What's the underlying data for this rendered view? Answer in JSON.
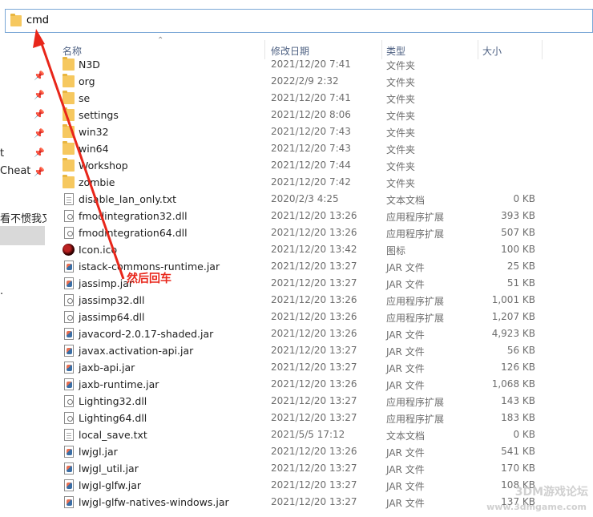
{
  "address": {
    "path": "cmd"
  },
  "nav": {
    "items": [
      {
        "label": "t"
      },
      {
        "label": "Cheat"
      },
      {
        "label": "看不惯我又"
      },
      {
        "label": "."
      }
    ]
  },
  "header": {
    "name": "名称",
    "date": "修改日期",
    "type": "类型",
    "size": "大小"
  },
  "files": [
    {
      "name": "N3D",
      "date": "2021/12/20 7:41",
      "type": "文件夹",
      "size": "",
      "icon": "folder-icon"
    },
    {
      "name": "org",
      "date": "2022/2/9 2:32",
      "type": "文件夹",
      "size": "",
      "icon": "folder-icon"
    },
    {
      "name": "se",
      "date": "2021/12/20 7:41",
      "type": "文件夹",
      "size": "",
      "icon": "folder-icon"
    },
    {
      "name": "settings",
      "date": "2021/12/20 8:06",
      "type": "文件夹",
      "size": "",
      "icon": "folder-icon"
    },
    {
      "name": "win32",
      "date": "2021/12/20 7:43",
      "type": "文件夹",
      "size": "",
      "icon": "folder-icon"
    },
    {
      "name": "win64",
      "date": "2021/12/20 7:43",
      "type": "文件夹",
      "size": "",
      "icon": "folder-icon"
    },
    {
      "name": "Workshop",
      "date": "2021/12/20 7:44",
      "type": "文件夹",
      "size": "",
      "icon": "folder-icon"
    },
    {
      "name": "zombie",
      "date": "2021/12/20 7:42",
      "type": "文件夹",
      "size": "",
      "icon": "folder-icon"
    },
    {
      "name": "disable_lan_only.txt",
      "date": "2020/2/3 4:25",
      "type": "文本文档",
      "size": "0 KB",
      "icon": "text-file-icon"
    },
    {
      "name": "fmodintegration32.dll",
      "date": "2021/12/20 13:26",
      "type": "应用程序扩展",
      "size": "393 KB",
      "icon": "dll-file-icon"
    },
    {
      "name": "fmodintegration64.dll",
      "date": "2021/12/20 13:26",
      "type": "应用程序扩展",
      "size": "507 KB",
      "icon": "dll-file-icon"
    },
    {
      "name": "Icon.ico",
      "date": "2021/12/20 13:42",
      "type": "图标",
      "size": "100 KB",
      "icon": "ico-file-icon"
    },
    {
      "name": "istack-commons-runtime.jar",
      "date": "2021/12/20 13:27",
      "type": "JAR 文件",
      "size": "25 KB",
      "icon": "jar-file-icon"
    },
    {
      "name": "jassimp.jar",
      "date": "2021/12/20 13:27",
      "type": "JAR 文件",
      "size": "51 KB",
      "icon": "jar-file-icon"
    },
    {
      "name": "jassimp32.dll",
      "date": "2021/12/20 13:26",
      "type": "应用程序扩展",
      "size": "1,001 KB",
      "icon": "dll-file-icon"
    },
    {
      "name": "jassimp64.dll",
      "date": "2021/12/20 13:26",
      "type": "应用程序扩展",
      "size": "1,207 KB",
      "icon": "dll-file-icon"
    },
    {
      "name": "javacord-2.0.17-shaded.jar",
      "date": "2021/12/20 13:26",
      "type": "JAR 文件",
      "size": "4,923 KB",
      "icon": "jar-file-icon"
    },
    {
      "name": "javax.activation-api.jar",
      "date": "2021/12/20 13:27",
      "type": "JAR 文件",
      "size": "56 KB",
      "icon": "jar-file-icon"
    },
    {
      "name": "jaxb-api.jar",
      "date": "2021/12/20 13:27",
      "type": "JAR 文件",
      "size": "126 KB",
      "icon": "jar-file-icon"
    },
    {
      "name": "jaxb-runtime.jar",
      "date": "2021/12/20 13:26",
      "type": "JAR 文件",
      "size": "1,068 KB",
      "icon": "jar-file-icon"
    },
    {
      "name": "Lighting32.dll",
      "date": "2021/12/20 13:27",
      "type": "应用程序扩展",
      "size": "143 KB",
      "icon": "dll-file-icon"
    },
    {
      "name": "Lighting64.dll",
      "date": "2021/12/20 13:27",
      "type": "应用程序扩展",
      "size": "183 KB",
      "icon": "dll-file-icon"
    },
    {
      "name": "local_save.txt",
      "date": "2021/5/5 17:12",
      "type": "文本文档",
      "size": "0 KB",
      "icon": "text-file-icon"
    },
    {
      "name": "lwjgl.jar",
      "date": "2021/12/20 13:26",
      "type": "JAR 文件",
      "size": "541 KB",
      "icon": "jar-file-icon"
    },
    {
      "name": "lwjgl_util.jar",
      "date": "2021/12/20 13:27",
      "type": "JAR 文件",
      "size": "170 KB",
      "icon": "jar-file-icon"
    },
    {
      "name": "lwjgl-glfw.jar",
      "date": "2021/12/20 13:27",
      "type": "JAR 文件",
      "size": "108 KB",
      "icon": "jar-file-icon"
    },
    {
      "name": "lwjgl-glfw-natives-windows.jar",
      "date": "2021/12/20 13:27",
      "type": "JAR 文件",
      "size": "137 KB",
      "icon": "jar-file-icon"
    }
  ],
  "annotation": {
    "text": "然后回车",
    "color": "#e8261a"
  },
  "watermark": {
    "line1": "3DM游戏论坛",
    "line2": "www.3dmgame.com"
  }
}
